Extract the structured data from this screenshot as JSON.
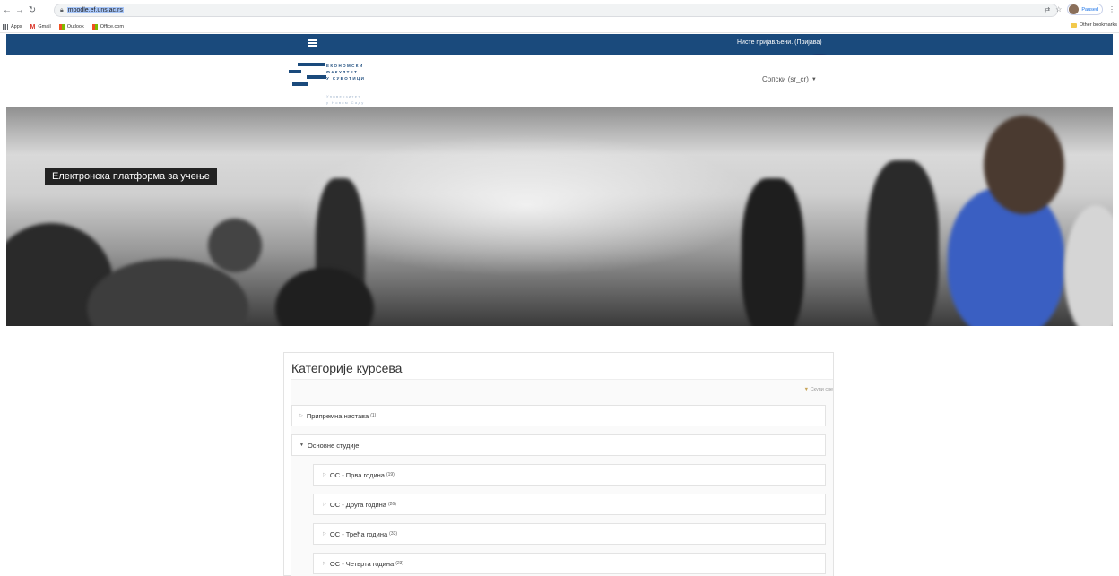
{
  "browser": {
    "url": "moodle.ef.uns.ac.rs",
    "profile_label": "Paused",
    "bookmarks": [
      {
        "label": "Apps",
        "icon": "apps-icon"
      },
      {
        "label": "Gmail",
        "icon": "gmail-icon"
      },
      {
        "label": "Outlook",
        "icon": "outlook-icon"
      },
      {
        "label": "Office.com",
        "icon": "office-icon"
      }
    ],
    "other_bookmarks": "Other bookmarks"
  },
  "navbar": {
    "status_text": "Нисте пријављени.",
    "login_link": "(Пријава)",
    "bg_color": "#1a4a7c"
  },
  "header": {
    "logo_lines": [
      "ЕКОНОМСКИ",
      "ФАКУЛТЕТ",
      "У СУБОТИЦИ"
    ],
    "logo_sub_lines": [
      "Универзитет",
      "у Новом Саду"
    ],
    "language": "Српски (sr_cr)"
  },
  "hero": {
    "title": "Електронска платформа за учење"
  },
  "categories": {
    "title": "Категорије курсева",
    "collapse_all": "Скупи све",
    "items": [
      {
        "label": "Припремна настава",
        "count": "(1)",
        "expanded": false
      },
      {
        "label": "Основне студије",
        "count": "",
        "expanded": true
      },
      {
        "label": "ОС - Прва година",
        "count": "(19)",
        "expanded": false
      },
      {
        "label": "ОС - Друга година",
        "count": "(26)",
        "expanded": false
      },
      {
        "label": "ОС - Трећа година",
        "count": "(33)",
        "expanded": false
      },
      {
        "label": "ОС - Четврта година",
        "count": "(23)",
        "expanded": false
      }
    ]
  }
}
